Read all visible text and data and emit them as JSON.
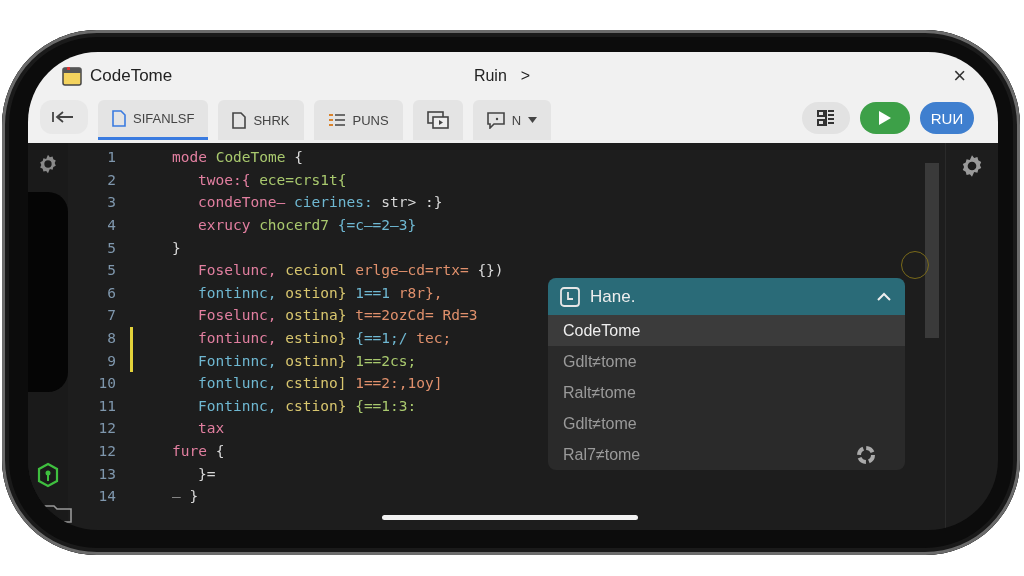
{
  "window": {
    "title": "CodeTome",
    "breadcrumb": "Ruin",
    "breadcrumb_chevron": ">",
    "close": "×"
  },
  "toolbar": {
    "tabs": [
      {
        "label": "SIFANLSF",
        "kind": "file",
        "selected": true
      },
      {
        "label": "SHRK",
        "kind": "file",
        "selected": false
      },
      {
        "label": "PUNS",
        "kind": "list",
        "selected": false
      },
      {
        "kind": "windows",
        "selected": false
      },
      {
        "label": "N",
        "kind": "chat",
        "selected": false
      }
    ],
    "run_label": "RUИ"
  },
  "editor": {
    "lines": [
      {
        "number": "1",
        "modified": false,
        "tokens": [
          {
            "text": "mode",
            "kind": "keyword"
          },
          {
            "text": "CodeTome",
            "kind": "name"
          },
          {
            "text": "{",
            "kind": "punct"
          }
        ],
        "children": [
          {
            "number": "2",
            "modified": false,
            "tokens": [
              {
                "text": "twoe:{",
                "kind": "keyword"
              },
              {
                "text": "ece=crs1t{",
                "kind": "name"
              }
            ]
          },
          {
            "number": "3",
            "modified": false,
            "tokens": [
              {
                "text": "condeTone–",
                "kind": "keyword"
              },
              {
                "text": "cierines:",
                "kind": "type"
              },
              {
                "text": "str> :}",
                "kind": "punct"
              }
            ]
          },
          {
            "number": "4",
            "modified": false,
            "tokens": [
              {
                "text": "exrucy",
                "kind": "keyword"
              },
              {
                "text": "chocerd7",
                "kind": "name"
              },
              {
                "text": "{=c–=2–3}",
                "kind": "type"
              }
            ]
          }
        ]
      },
      {
        "number": "5",
        "modified": false,
        "tokens": [
          {
            "text": "}",
            "kind": "punct"
          }
        ],
        "children": [
          {
            "number": "5",
            "modified": false,
            "tokens": [
              {
                "text": "Foselunc,",
                "kind": "keyword"
              },
              {
                "text": "cecionl",
                "kind": "string"
              },
              {
                "text": "erlge–cd=rtx=",
                "kind": "number"
              },
              {
                "text": "{})",
                "kind": "punct"
              }
            ]
          },
          {
            "number": "6",
            "modified": false,
            "tokens": [
              {
                "text": "fontinnc,",
                "kind": "type"
              },
              {
                "text": "ostion}",
                "kind": "string"
              },
              {
                "text": "1==1",
                "kind": "type"
              },
              {
                "text": "r8r},",
                "kind": "number"
              }
            ]
          },
          {
            "number": "7",
            "modified": false,
            "tokens": [
              {
                "text": "Foselunc,",
                "kind": "keyword"
              },
              {
                "text": "ostina}",
                "kind": "string"
              },
              {
                "text": "t==2ozCd=",
                "kind": "number"
              },
              {
                "text": "Rd=3",
                "kind": "number"
              }
            ]
          },
          {
            "number": "8",
            "modified": true,
            "tokens": [
              {
                "text": "fontiunc,",
                "kind": "keyword"
              },
              {
                "text": "estino}",
                "kind": "string"
              },
              {
                "text": "{==1;/",
                "kind": "type"
              },
              {
                "text": "tec;",
                "kind": "number"
              }
            ]
          },
          {
            "number": "9",
            "modified": true,
            "tokens": [
              {
                "text": "Fontinnc,",
                "kind": "type"
              },
              {
                "text": "ostinn}",
                "kind": "string"
              },
              {
                "text": "1==2cs;",
                "kind": "name"
              }
            ]
          },
          {
            "number": "10",
            "modified": false,
            "tokens": [
              {
                "text": "fontlunc,",
                "kind": "type"
              },
              {
                "text": "cstino]",
                "kind": "string"
              },
              {
                "text": "1==2:,1oy]",
                "kind": "number"
              }
            ]
          },
          {
            "number": "11",
            "modified": false,
            "tokens": [
              {
                "text": "Fontinnc,",
                "kind": "type"
              },
              {
                "text": "cstion}",
                "kind": "string"
              },
              {
                "text": "{==1:3:",
                "kind": "name"
              }
            ]
          },
          {
            "number": "12",
            "modified": false,
            "tokens": [
              {
                "text": "tax",
                "kind": "keyword"
              }
            ]
          }
        ]
      },
      {
        "number": "12",
        "modified": false,
        "tokens": [
          {
            "text": "fure",
            "kind": "keyword"
          },
          {
            "text": "{",
            "kind": "punct"
          }
        ],
        "children": [
          {
            "number": "13",
            "modified": false,
            "tokens": [
              {
                "text": "}=",
                "kind": "punct"
              }
            ]
          }
        ]
      },
      {
        "number": "14",
        "modified": false,
        "tokens": [
          {
            "text": "–",
            "kind": "comment"
          },
          {
            "text": "}",
            "kind": "punct"
          }
        ]
      }
    ]
  },
  "popup": {
    "title": "Hane.",
    "items": [
      {
        "label": "CodeTome",
        "selected": true
      },
      {
        "label": "Gdlt≠tome",
        "selected": false
      },
      {
        "label": "Ralt≠tome",
        "selected": false
      },
      {
        "label": "Gdlt≠tome",
        "selected": false
      },
      {
        "label": "Ral7≠tome",
        "selected": false,
        "kind": "spinner"
      }
    ]
  }
}
